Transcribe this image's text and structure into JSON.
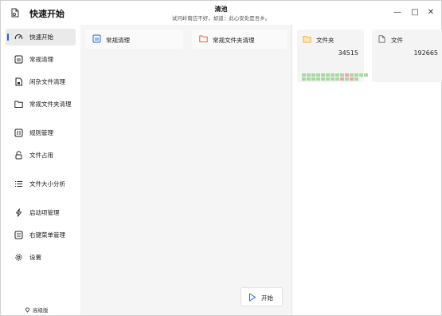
{
  "app": {
    "title": "快速开始"
  },
  "header": {
    "title": "清池",
    "subtitle": "试问岭南应不好，却道：此心安处是吾乡。"
  },
  "window_controls": {
    "minimize": "—",
    "maximize": "□",
    "close": "✕"
  },
  "sidebar": {
    "items": [
      {
        "label": "快速开始",
        "icon": "speedometer-icon",
        "active": true
      },
      {
        "label": "常规清理",
        "icon": "hard-drive-icon",
        "active": false
      },
      {
        "label": "闲杂文件清理",
        "icon": "document-icon",
        "active": false
      },
      {
        "label": "常规文件夹清理",
        "icon": "folder-icon",
        "active": false
      },
      {
        "label": "规则管理",
        "icon": "rules-icon",
        "active": false
      },
      {
        "label": "文件占用",
        "icon": "lock-icon",
        "active": false
      },
      {
        "label": "文件大小分析",
        "icon": "list-icon",
        "active": false
      },
      {
        "label": "启动项管理",
        "icon": "lightning-icon",
        "active": false
      },
      {
        "label": "右键菜单管理",
        "icon": "context-menu-icon",
        "active": false
      },
      {
        "label": "设置",
        "icon": "gear-icon",
        "active": false
      }
    ],
    "edition_label": "高级版"
  },
  "main": {
    "cards": [
      {
        "label": "常规清理",
        "icon": "hard-drive-icon"
      },
      {
        "label": "常规文件夹清理",
        "icon": "folder-icon"
      }
    ],
    "start_button": "开始"
  },
  "stats": [
    {
      "label": "文件夹",
      "value": "34515",
      "icon": "folder-icon"
    },
    {
      "label": "文件",
      "value": "192665",
      "icon": "file-icon"
    }
  ],
  "colors": {
    "accent": "#1e63d6",
    "grid_green": "#a9d9a3",
    "grid_red": "#f2a3a3",
    "folder_orange": "#f0b43c",
    "folder_red": "#e8613a"
  },
  "status_grid": [
    [
      "g",
      "g",
      "g",
      "g",
      "g",
      "g",
      "g",
      "g",
      "g",
      "r",
      "g",
      "g",
      "g",
      "g"
    ],
    [
      "g",
      "g",
      "g",
      "g",
      "g",
      "g",
      "g",
      "g",
      "r",
      "g",
      "r",
      "g",
      "x",
      "x"
    ]
  ]
}
